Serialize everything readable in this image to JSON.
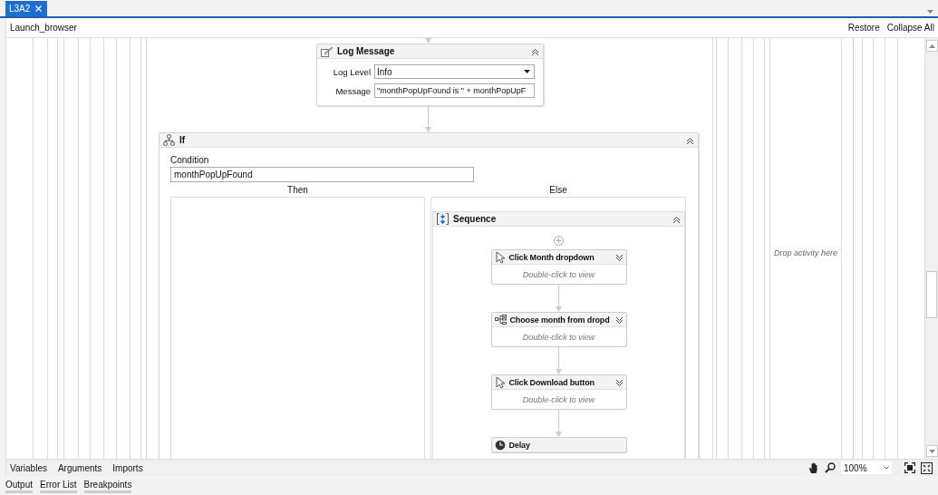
{
  "tabs": [
    {
      "label": "L3A2",
      "selected": true
    }
  ],
  "breadcrumb": "Launch_browser",
  "header_actions": [
    "Restore",
    "Collapse All"
  ],
  "log_message": {
    "title": "Log Message",
    "expanded": true,
    "fields": [
      {
        "label": "Log Level",
        "value": "Info",
        "kind": "dropdown"
      },
      {
        "label": "Message",
        "value": "\"monthPopUpFound is \" + monthPopUpF",
        "kind": "text"
      }
    ]
  },
  "if_activity": {
    "title": "If",
    "expanded": true,
    "condition_label": "Condition",
    "condition": "monthPopUpFound",
    "then_label": "Then",
    "else_label": "Else",
    "else_sequence": {
      "title": "Sequence",
      "expanded": true,
      "activities": [
        {
          "title": "Click Month dropdown",
          "kind": "click",
          "expanded": false,
          "hint": "Double-click to view"
        },
        {
          "title": "Choose month from dropd",
          "kind": "select",
          "expanded": false,
          "hint": "Double-click to view"
        },
        {
          "title": "Click Download button",
          "kind": "click",
          "expanded": false,
          "hint": "Double-click to view"
        },
        {
          "title": "Delay",
          "kind": "delay"
        }
      ]
    }
  },
  "drop_hint": "Drop activity here",
  "designer_tabs": [
    "Variables",
    "Arguments",
    "Imports"
  ],
  "zoom": "100%",
  "panel_tabs": [
    "Output",
    "Error List",
    "Breakpoints"
  ]
}
